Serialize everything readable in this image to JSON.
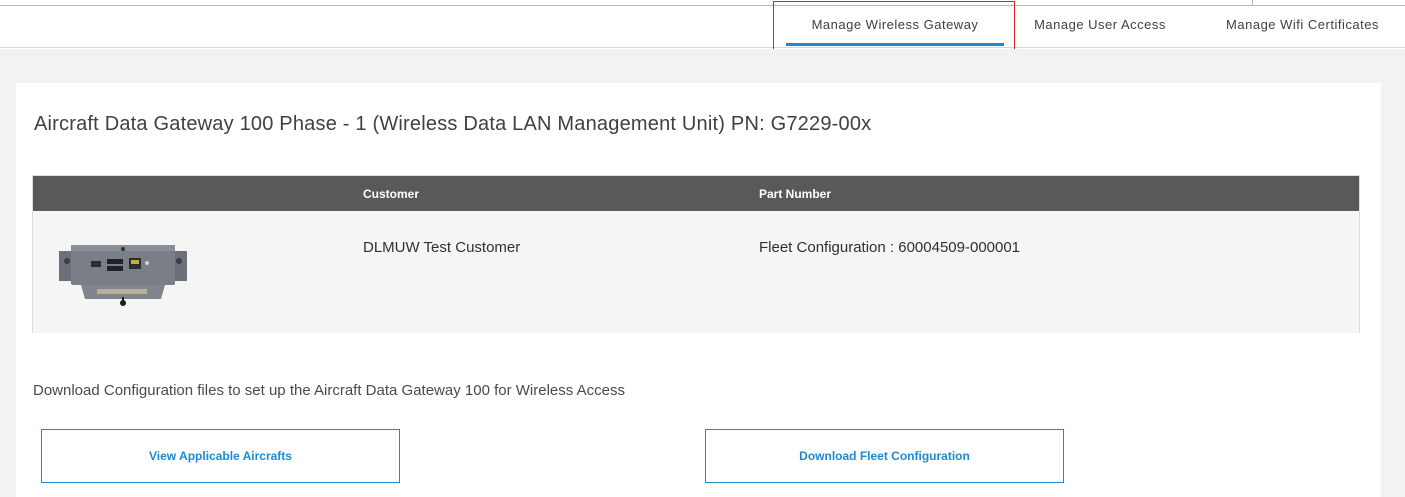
{
  "nav": {
    "tabs": [
      {
        "label": "Manage Wireless Gateway",
        "active": true
      },
      {
        "label": "Manage User Access",
        "active": false
      },
      {
        "label": "Manage Wifi Certificates",
        "active": false
      }
    ],
    "active_color": "#1e8ad3",
    "highlight_color": "#e02020"
  },
  "page": {
    "title": "Aircraft Data Gateway 100 Phase - 1 (Wireless Data LAN Management Unit) PN: G7229-00x"
  },
  "table": {
    "headers": [
      "Customer",
      "Part Number"
    ],
    "rows": [
      {
        "image": "gateway-device-image",
        "customer": "DLMUW Test Customer",
        "part_number": "Fleet Configuration : 60004509-000001"
      }
    ],
    "header_bg": "#595959"
  },
  "instructions": "Download Configuration files to set up the Aircraft Data Gateway 100 for Wireless Access",
  "buttons": {
    "view_aircrafts": "View Applicable Aircrafts",
    "download_fleet": "Download Fleet Configuration"
  }
}
